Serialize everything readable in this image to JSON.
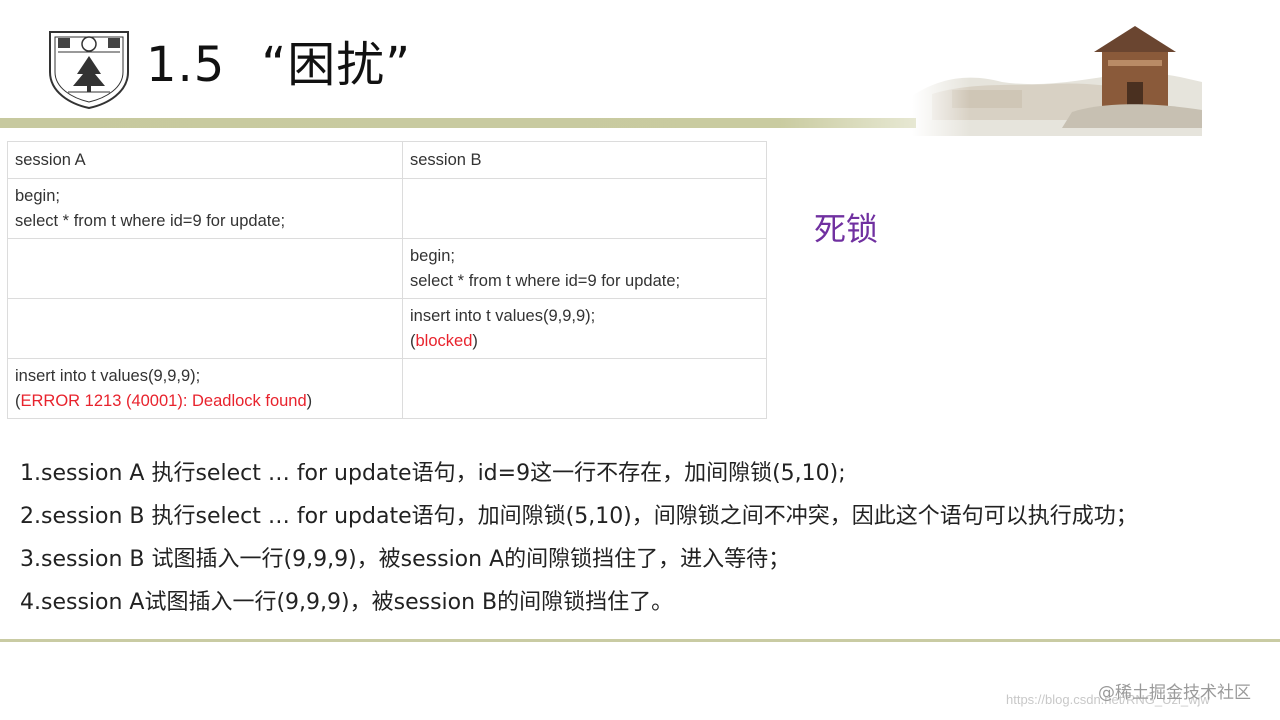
{
  "header": {
    "logo_icon": "nanjing-university-seal-icon",
    "slide_number": "1.5",
    "slide_title": "“困扰”",
    "photo_icon": "university-building-photo-icon"
  },
  "table": {
    "headers": [
      "session A",
      "session B"
    ],
    "rows": [
      {
        "a": [
          "begin;",
          "select * from t where id=9 for update;"
        ],
        "b": []
      },
      {
        "a": [],
        "b": [
          "begin;",
          "select * from t where id=9 for update;"
        ]
      },
      {
        "a": [],
        "b": [
          "insert into t values(9,9,9);",
          {
            "pre": "(",
            "red": "blocked",
            "post": ")"
          }
        ]
      },
      {
        "a": [
          "insert into t values(9,9,9);",
          {
            "pre": "(",
            "red": "ERROR 1213 (40001): Deadlock found",
            "post": ")"
          }
        ],
        "b": []
      }
    ]
  },
  "side_label": "死锁",
  "explanations": [
    "1.session A 执行select … for update语句，id=9这一行不存在，加间隙锁(5,10);",
    "2.session B 执行select … for update语句，加间隙锁(5,10)，间隙锁之间不冲突，因此这个语句可以执行成功；",
    "3.session B 试图插入一行(9,9,9)，被session A的间隙锁挡住了，进入等待；",
    "4.session A试图插入一行(9,9,9)，被session B的间隙锁挡住了。"
  ],
  "watermark": {
    "brand": "@稀土掘金技术社区",
    "url": "https://blog.csdn.net/RNG_Uzi_wjw"
  },
  "colors": {
    "accent_band": "#c9cba0",
    "error_red": "#e8232d",
    "side_label_purple": "#7030a0"
  }
}
